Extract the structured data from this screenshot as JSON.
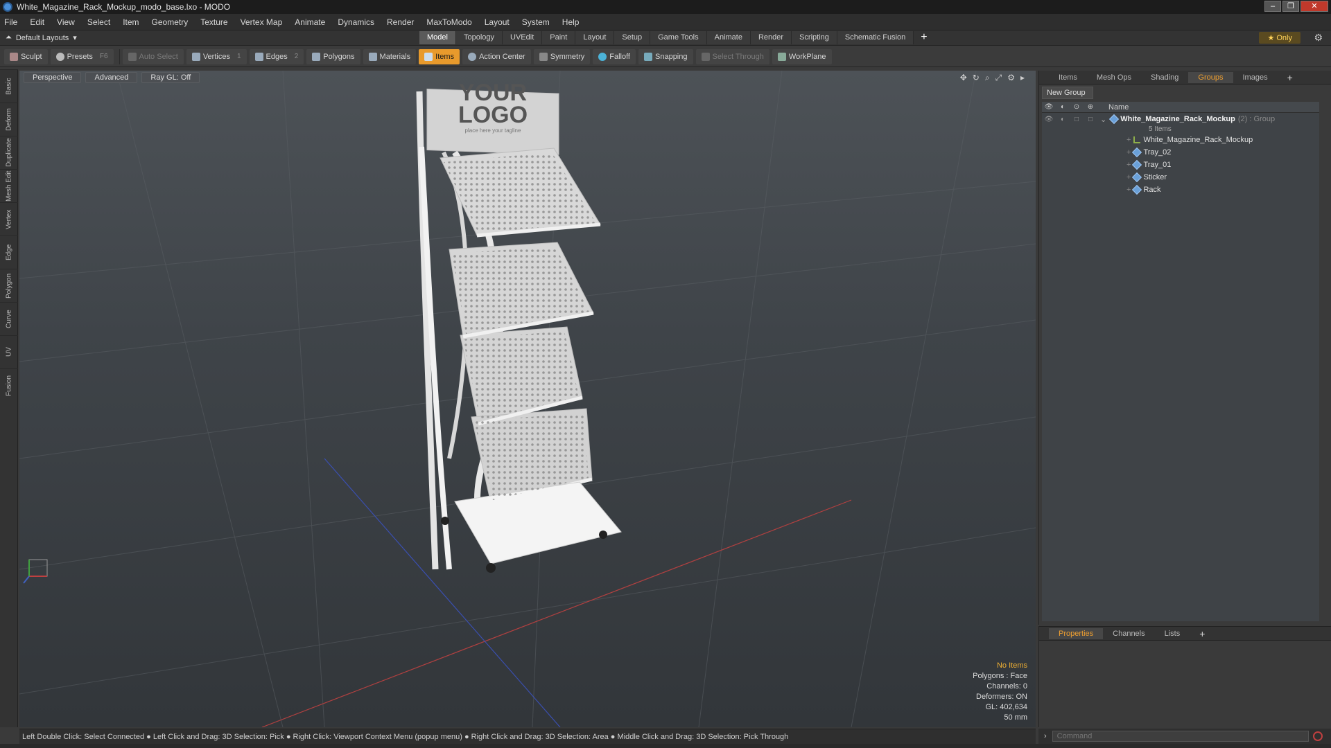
{
  "window": {
    "title": "White_Magazine_Rack_Mockup_modo_base.lxo - MODO",
    "controls": [
      "‒",
      "❐",
      "✕"
    ]
  },
  "menu": [
    "File",
    "Edit",
    "View",
    "Select",
    "Item",
    "Geometry",
    "Texture",
    "Vertex Map",
    "Animate",
    "Dynamics",
    "Render",
    "MaxToModo",
    "Layout",
    "System",
    "Help"
  ],
  "layouts": {
    "dropdown": "Default Layouts",
    "tabs": [
      "Model",
      "Topology",
      "UVEdit",
      "Paint",
      "Layout",
      "Setup",
      "Game Tools",
      "Animate",
      "Render",
      "Scripting",
      "Schematic Fusion"
    ],
    "active_tab": "Model",
    "only_label": "Only"
  },
  "toolbar": {
    "sculpt": "Sculpt",
    "presets": "Presets",
    "presets_key": "F6",
    "auto_select": "Auto Select",
    "vertices": "Vertices",
    "vertices_num": "1",
    "edges": "Edges",
    "edges_num": "2",
    "polygons": "Polygons",
    "materials": "Materials",
    "items": "Items",
    "action_center": "Action Center",
    "symmetry": "Symmetry",
    "falloff": "Falloff",
    "snapping": "Snapping",
    "select_through": "Select Through",
    "workplane": "WorkPlane"
  },
  "left_tabs": [
    "Basic",
    "Deform",
    "Duplicate",
    "Mesh Edit",
    "Vertex",
    "Edge",
    "Polygon",
    "Curve",
    "UV",
    "Fusion"
  ],
  "viewport": {
    "view": "Perspective",
    "style": "Advanced",
    "raygl": "Ray GL: Off",
    "logo_line1": "YOUR",
    "logo_line2": "LOGO",
    "logo_tagline": "place here your tagline",
    "info": {
      "no_items": "No Items",
      "polygons": "Polygons : Face",
      "channels": "Channels: 0",
      "deformers": "Deformers: ON",
      "gl": "GL: 402,634",
      "unit": "50 mm"
    }
  },
  "status_bar": "Left Double Click: Select Connected ● Left Click and Drag: 3D Selection: Pick ● Right Click: Viewport Context Menu (popup menu) ● Right Click and Drag: 3D Selection: Area ● Middle Click and Drag: 3D Selection: Pick Through",
  "right_panel": {
    "tabs": [
      "Items",
      "Mesh Ops",
      "Shading",
      "Groups",
      "Images"
    ],
    "active_tab": "Groups",
    "new_group": "New Group",
    "name_header": "Name",
    "group": {
      "name": "White_Magazine_Rack_Mockup",
      "meta": "(2) : Group",
      "count": "5 Items"
    },
    "items": [
      "White_Magazine_Rack_Mockup",
      "Tray_02",
      "Tray_01",
      "Sticker",
      "Rack"
    ]
  },
  "properties": {
    "tabs": [
      "Properties",
      "Channels",
      "Lists"
    ],
    "active_tab": "Properties"
  },
  "command": {
    "placeholder": "Command"
  },
  "colors": {
    "accent": "#e89a2c",
    "active_tab_text": "#f0a030",
    "warning": "#f2b233"
  }
}
